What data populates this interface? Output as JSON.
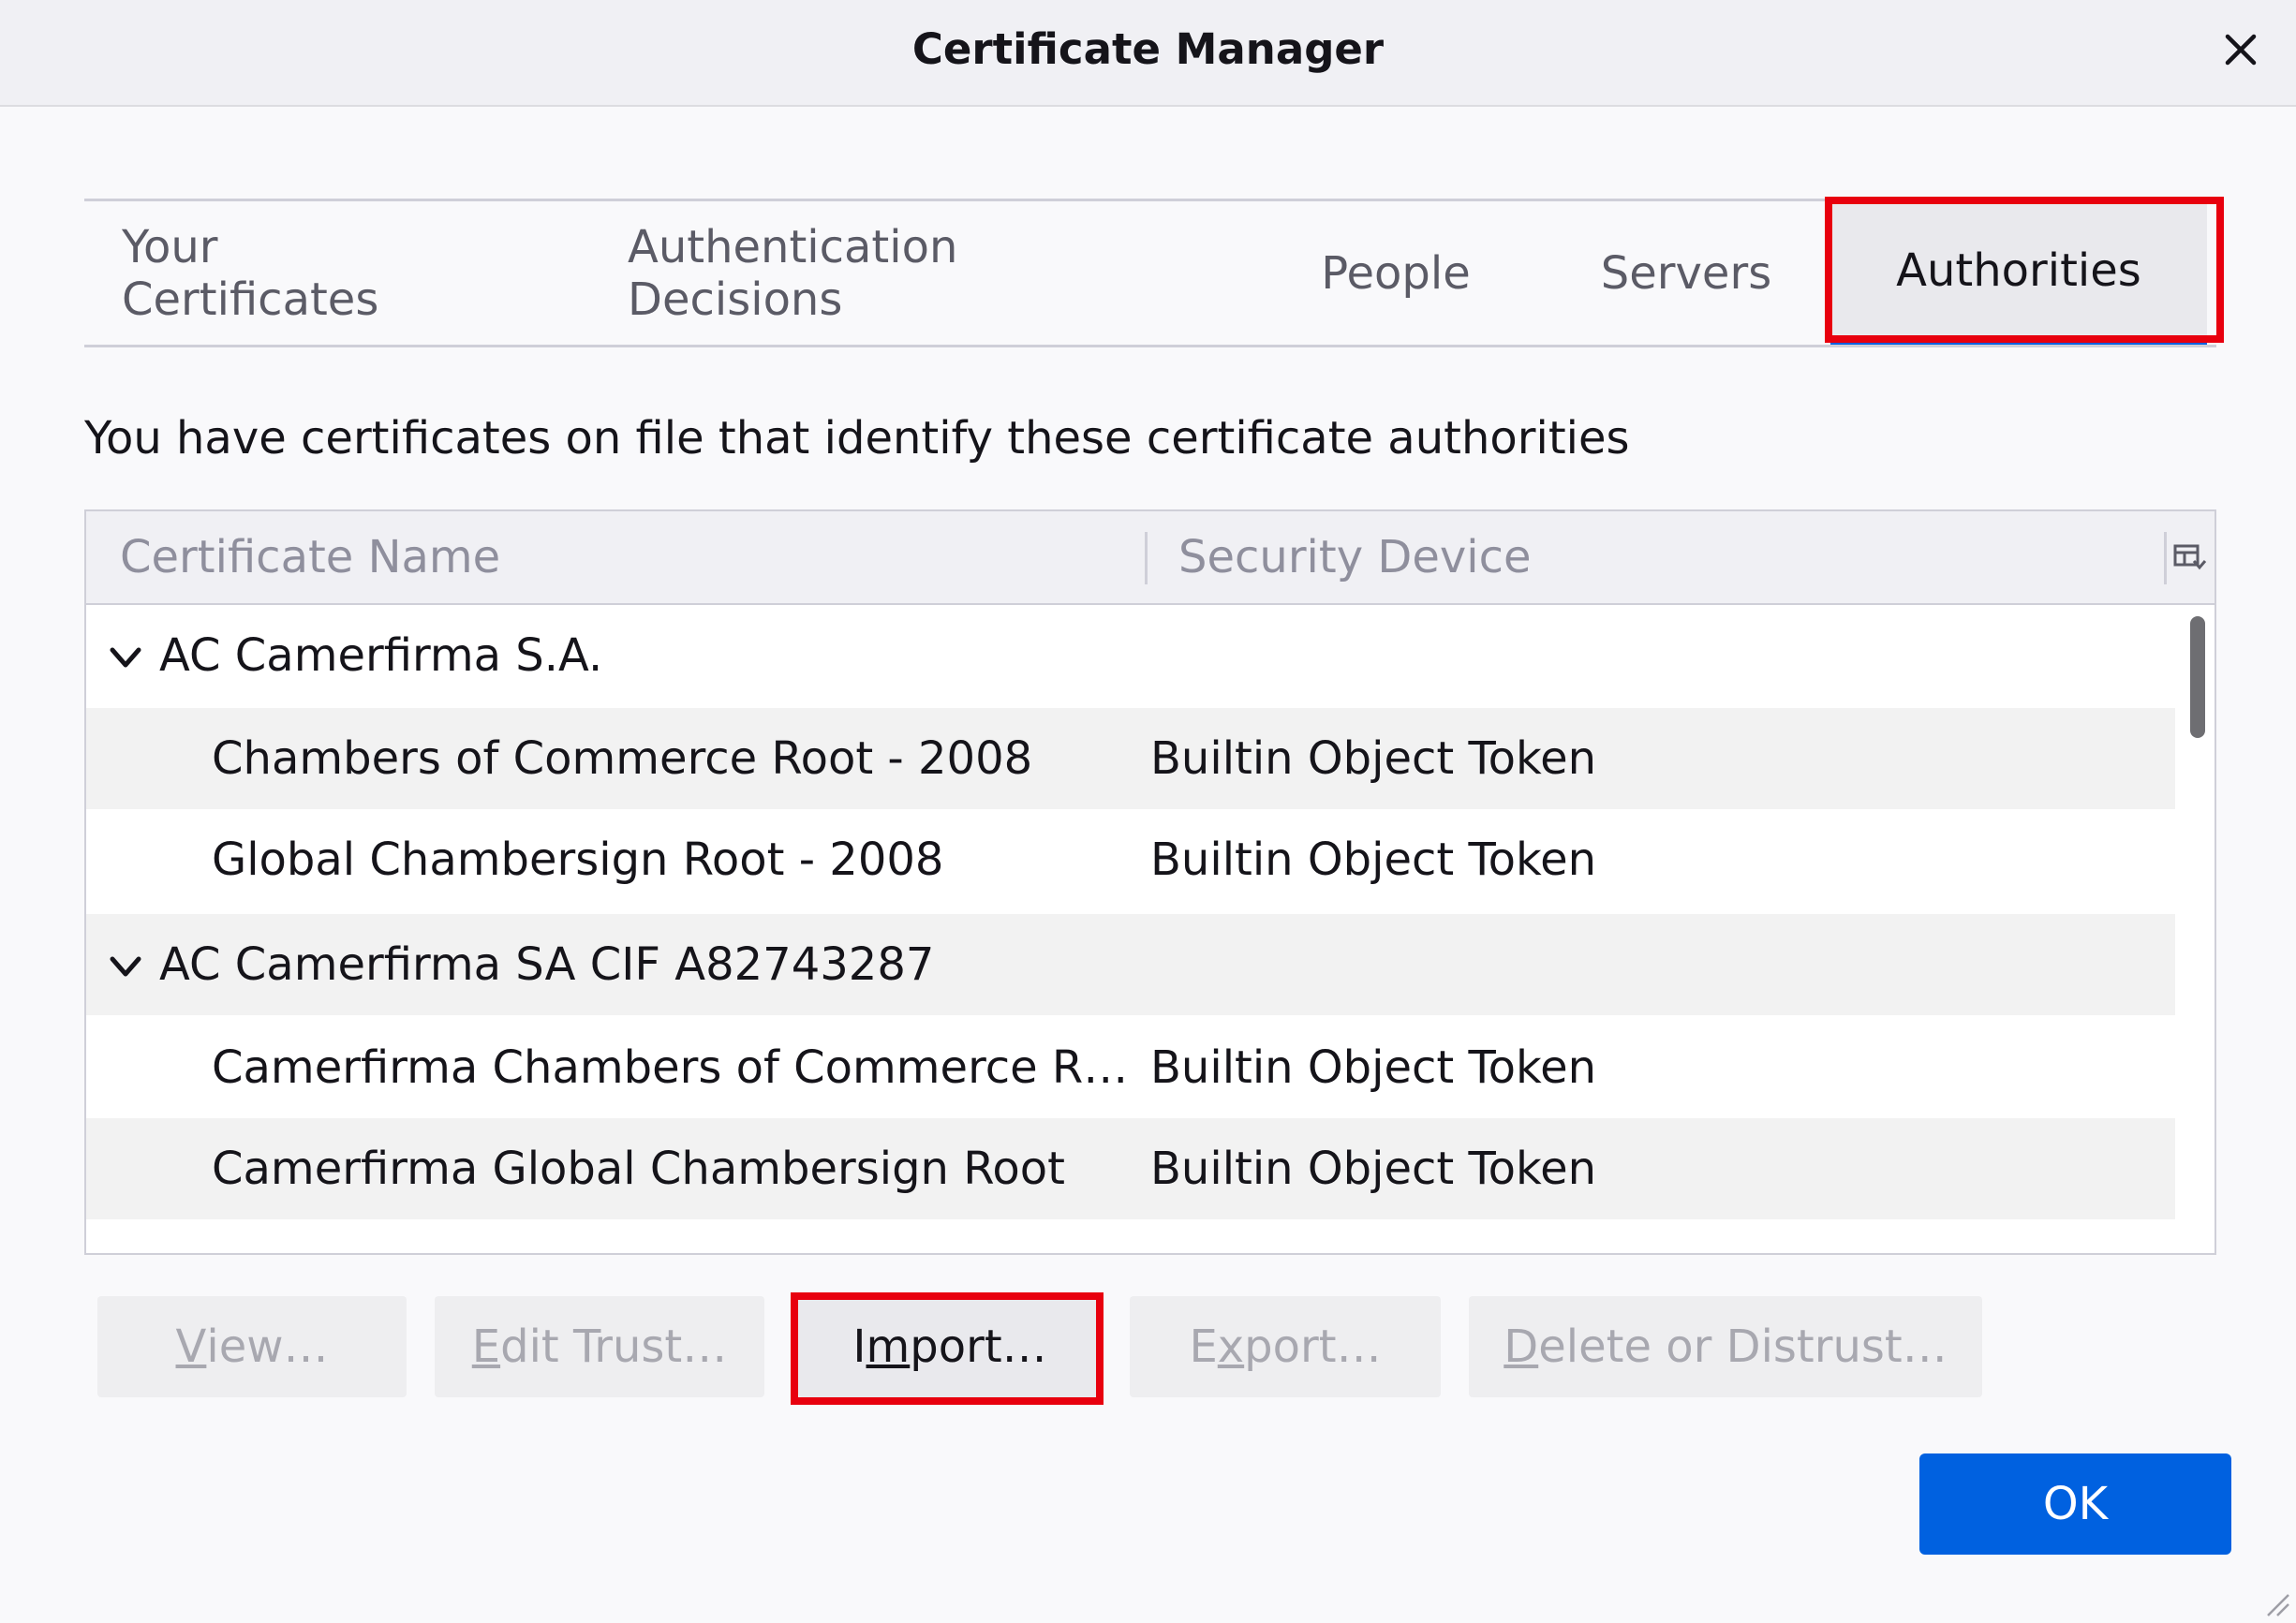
{
  "window": {
    "title": "Certificate Manager",
    "close_label": "×"
  },
  "tabs": [
    {
      "label": "Your Certificates",
      "selected": false
    },
    {
      "label": "Authentication Decisions",
      "selected": false
    },
    {
      "label": "People",
      "selected": false
    },
    {
      "label": "Servers",
      "selected": false
    },
    {
      "label": "Authorities",
      "selected": true
    }
  ],
  "description": "You have certificates on file that identify these certificate authorities",
  "tree": {
    "columns": [
      "Certificate Name",
      "Security Device"
    ],
    "rows": [
      {
        "type": "group",
        "name": "AC Camerfirma S.A.",
        "device": ""
      },
      {
        "type": "item",
        "name": "Chambers of Commerce Root - 2008",
        "device": "Builtin Object Token"
      },
      {
        "type": "item",
        "name": "Global Chambersign Root - 2008",
        "device": "Builtin Object Token"
      },
      {
        "type": "group",
        "name": "AC Camerfirma SA CIF A82743287",
        "device": ""
      },
      {
        "type": "item",
        "name": "Camerfirma Chambers of Commerce R…",
        "device": "Builtin Object Token"
      },
      {
        "type": "item",
        "name": "Camerfirma Global Chambersign Root",
        "device": "Builtin Object Token"
      }
    ]
  },
  "buttons": [
    {
      "id": "view",
      "pre": "",
      "key": "V",
      "post": "iew…",
      "enabled": false
    },
    {
      "id": "edit-trust",
      "pre": "",
      "key": "E",
      "post": "dit Trust…",
      "enabled": false
    },
    {
      "id": "import",
      "pre": "I",
      "key": "m",
      "post": "port…",
      "enabled": true
    },
    {
      "id": "export",
      "pre": "E",
      "key": "x",
      "post": "port…",
      "enabled": false
    },
    {
      "id": "delete-distrust",
      "pre": "",
      "key": "D",
      "post": "elete or Distrust…",
      "enabled": false
    }
  ],
  "ok_label": "OK",
  "colors": {
    "accent": "#0061e0",
    "highlight": "#e8000e"
  }
}
